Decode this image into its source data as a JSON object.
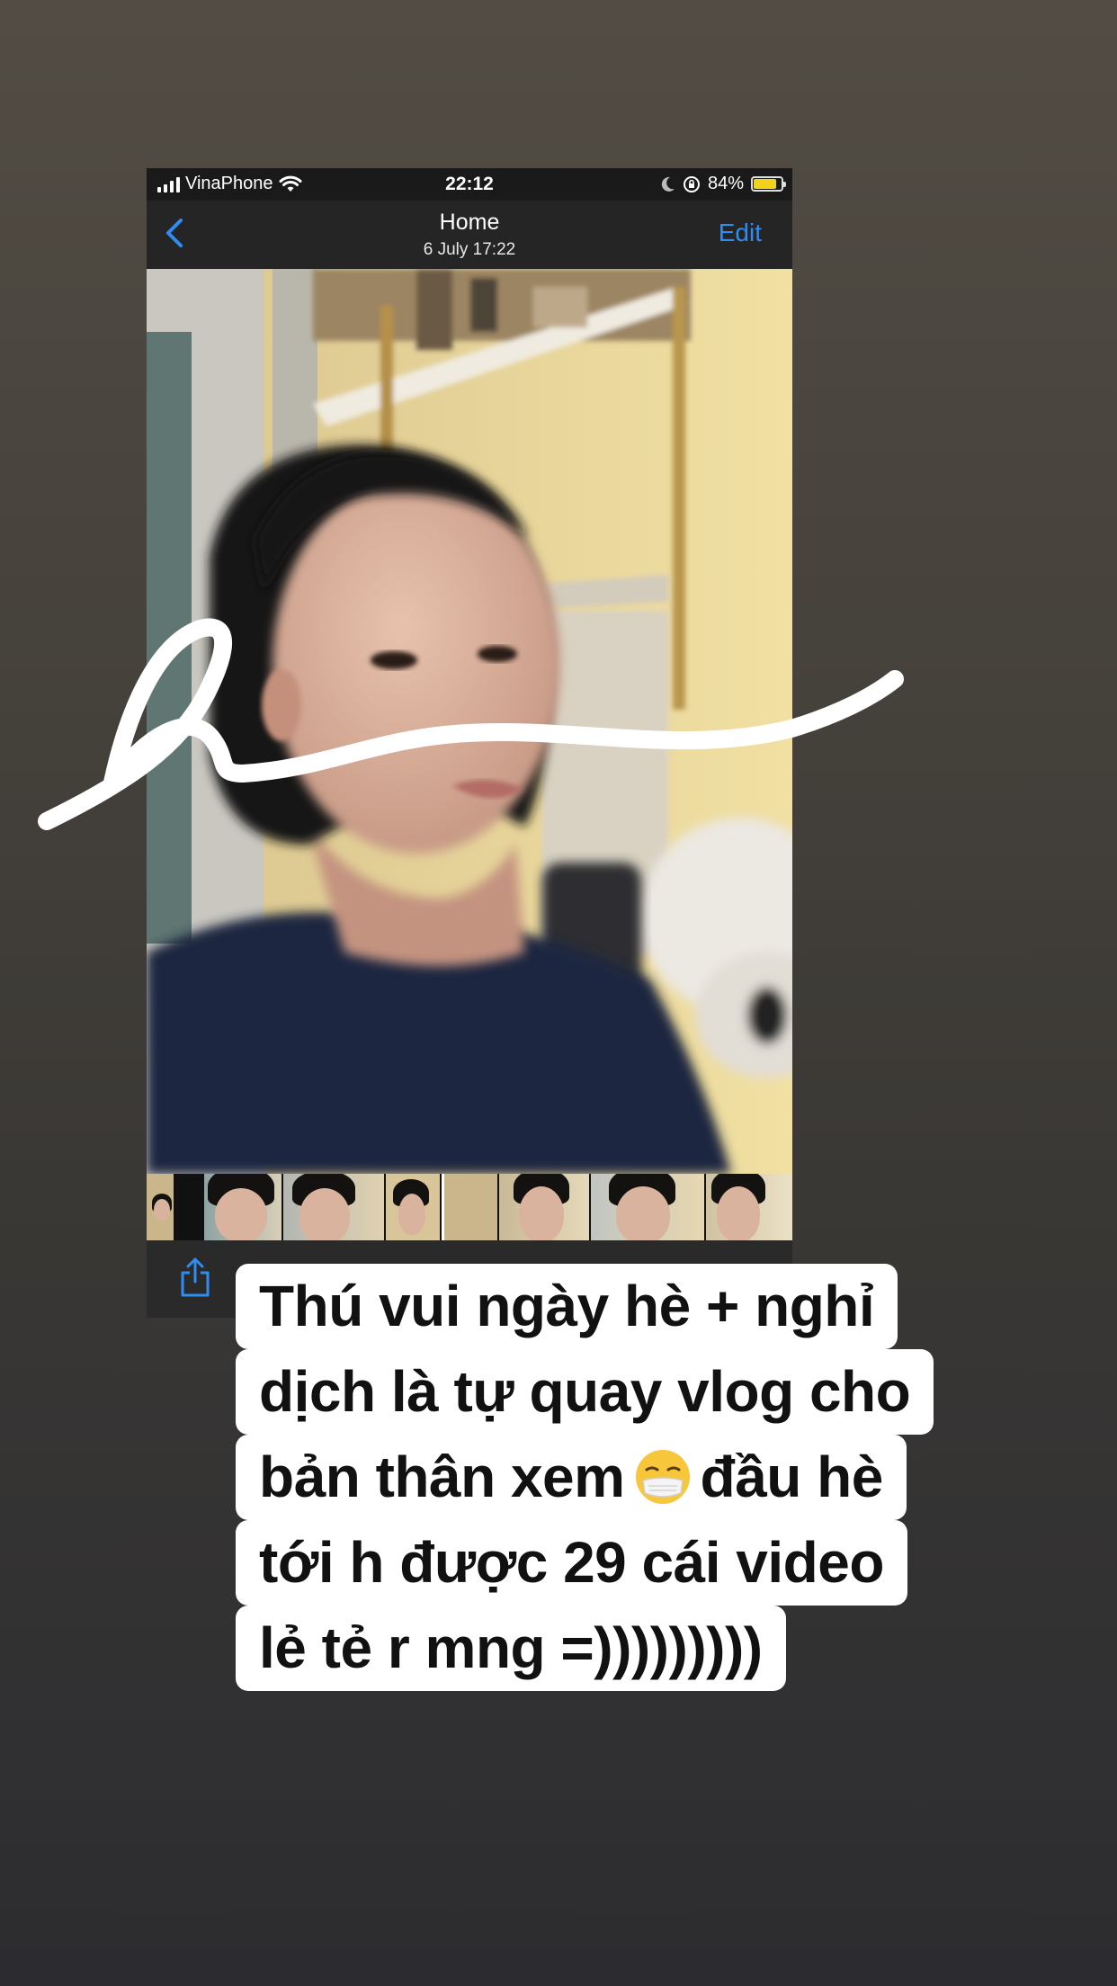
{
  "status_bar": {
    "carrier": "VinaPhone",
    "time": "22:12",
    "battery_percent": "84%",
    "battery_level": 0.84,
    "battery_color": "#f2d31b"
  },
  "nav": {
    "title": "Home",
    "subtitle": "6 July  17:22",
    "edit_label": "Edit",
    "accent_color": "#2f8cf0"
  },
  "icons": {
    "back": "chevron-left-icon",
    "share": "share-icon",
    "wifi": "wifi-icon",
    "moon": "moon-icon",
    "rotation_lock": "rotation-lock-icon",
    "emoji": "face-with-medical-mask-emoji"
  },
  "caption": {
    "lines": [
      "Thú vui ngày hè + nghỉ",
      "dịch là tự quay vlog cho",
      "bản thân xem",
      "đầu hè",
      "tới h được 29 cái video",
      "lẻ tẻ r mng =)))))))))"
    ]
  }
}
